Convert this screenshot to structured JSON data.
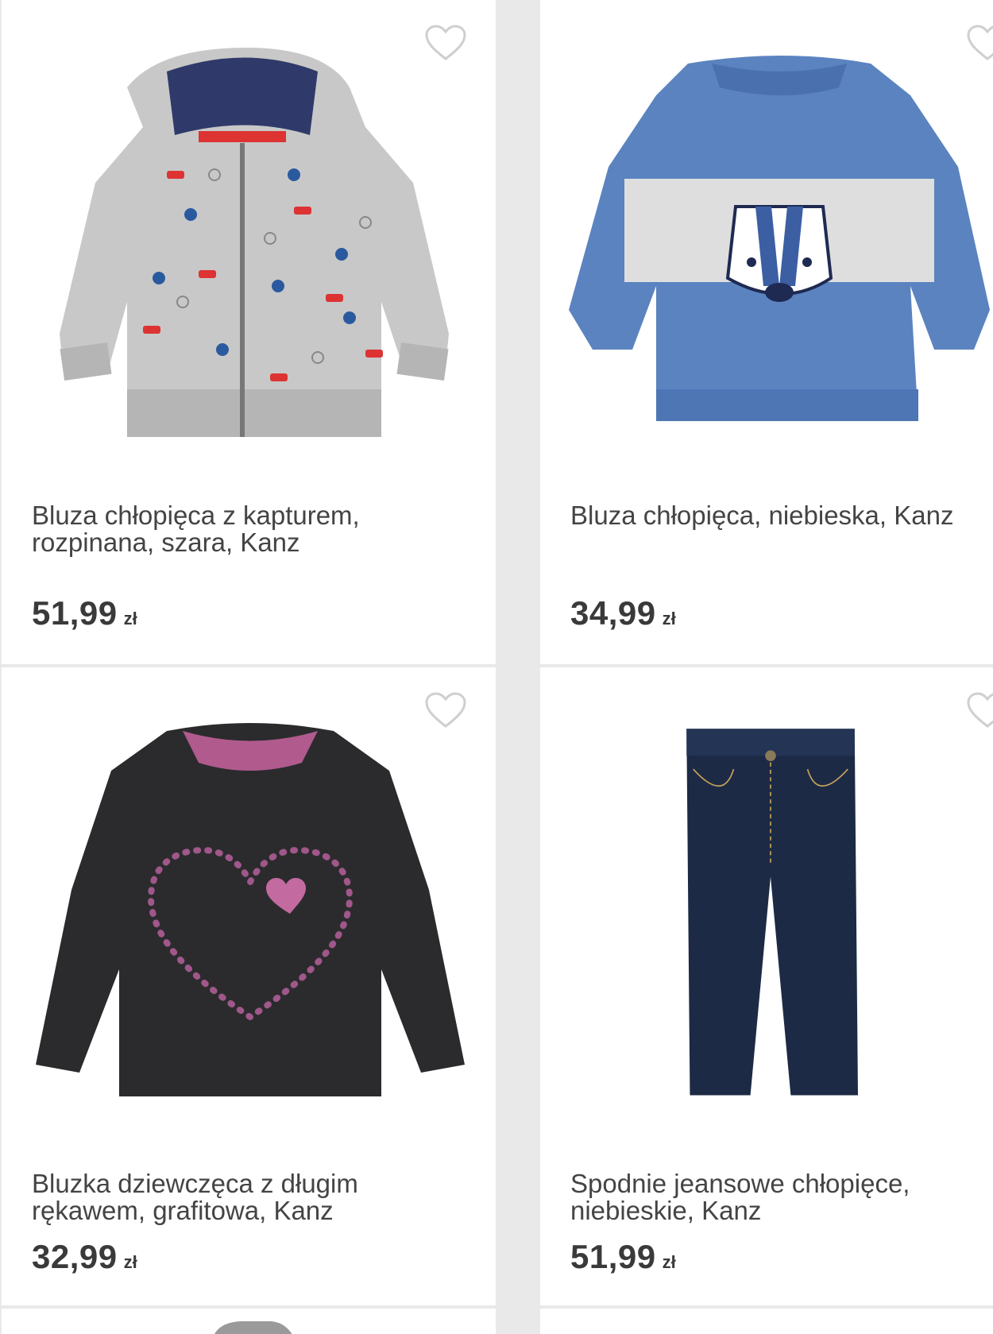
{
  "products": [
    {
      "title": "Bluza chłopięca z kapturem, rozpinana, szara, Kanz",
      "price": "51,99",
      "currency": "zł"
    },
    {
      "title": "Bluza chłopięca, niebieska, Kanz",
      "price": "34,99",
      "currency": "zł"
    },
    {
      "title": "Bluzka dziewczęca z długim rękawem, grafitowa, Kanz",
      "price": "32,99",
      "currency": "zł"
    },
    {
      "title": "Spodnie jeansowe chłopięce, niebieskie, Kanz",
      "price": "51,99",
      "currency": "zł"
    }
  ],
  "icons": {
    "favorite": "heart-outline-icon"
  },
  "colors": {
    "card_bg": "#ffffff",
    "page_bg": "#e9e9e9",
    "text": "#3a3a3a"
  }
}
